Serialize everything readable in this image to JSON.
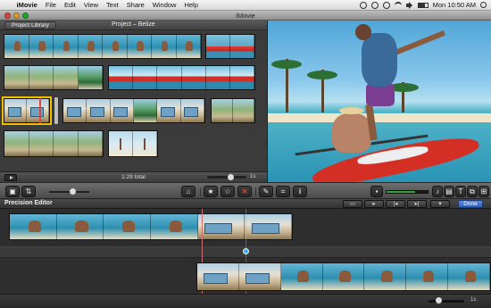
{
  "menubar": {
    "apple": "",
    "items": [
      "iMovie",
      "File",
      "Edit",
      "View",
      "Text",
      "Share",
      "Window",
      "Help"
    ],
    "clock": "Mon 10:50 AM"
  },
  "window": {
    "title": "iMovie"
  },
  "project": {
    "library_button": "Project Library",
    "title": "Project – Belize",
    "total": "1:29 total",
    "zoom_readout": "1s"
  },
  "toolbar": {
    "star": "★",
    "unstar": "☆",
    "reject": "✕",
    "info": "i",
    "text_tool": "T"
  },
  "precision_editor": {
    "title": "Precision Editor",
    "done_label": "Done",
    "zoom_label": "1s"
  },
  "colors": {
    "accent_blue": "#3b6fd0",
    "reject_red": "#e8443a",
    "selection_yellow": "#f0c000"
  }
}
